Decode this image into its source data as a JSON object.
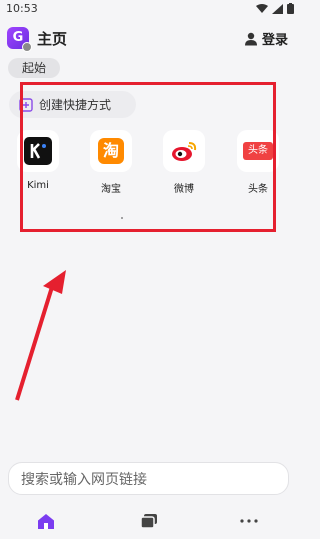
{
  "status_bar": {
    "time": "10:53",
    "icons": [
      "wifi-icon",
      "signal-icon",
      "battery-icon"
    ]
  },
  "header": {
    "logo_letter": "G",
    "title": "主页",
    "login_label": "登录"
  },
  "chips": [
    {
      "label": "起始"
    }
  ],
  "shortcut": {
    "create_label": "创建快捷方式"
  },
  "apps": [
    {
      "label": "Kimi",
      "icon": "kimi-icon"
    },
    {
      "label": "淘宝",
      "icon": "taobao-icon",
      "glyph": "淘"
    },
    {
      "label": "微博",
      "icon": "weibo-icon"
    },
    {
      "label": "头条",
      "icon": "toutiao-icon",
      "glyph": "头条"
    }
  ],
  "search": {
    "placeholder": "搜索或输入网页链接"
  },
  "bottom_nav": [
    "home-icon",
    "tabs-icon",
    "more-icon"
  ],
  "colors": {
    "accent": "#7b3cf0",
    "annotation": "#e5202f",
    "taobao": "#ff8a00",
    "toutiao": "#f04142"
  }
}
